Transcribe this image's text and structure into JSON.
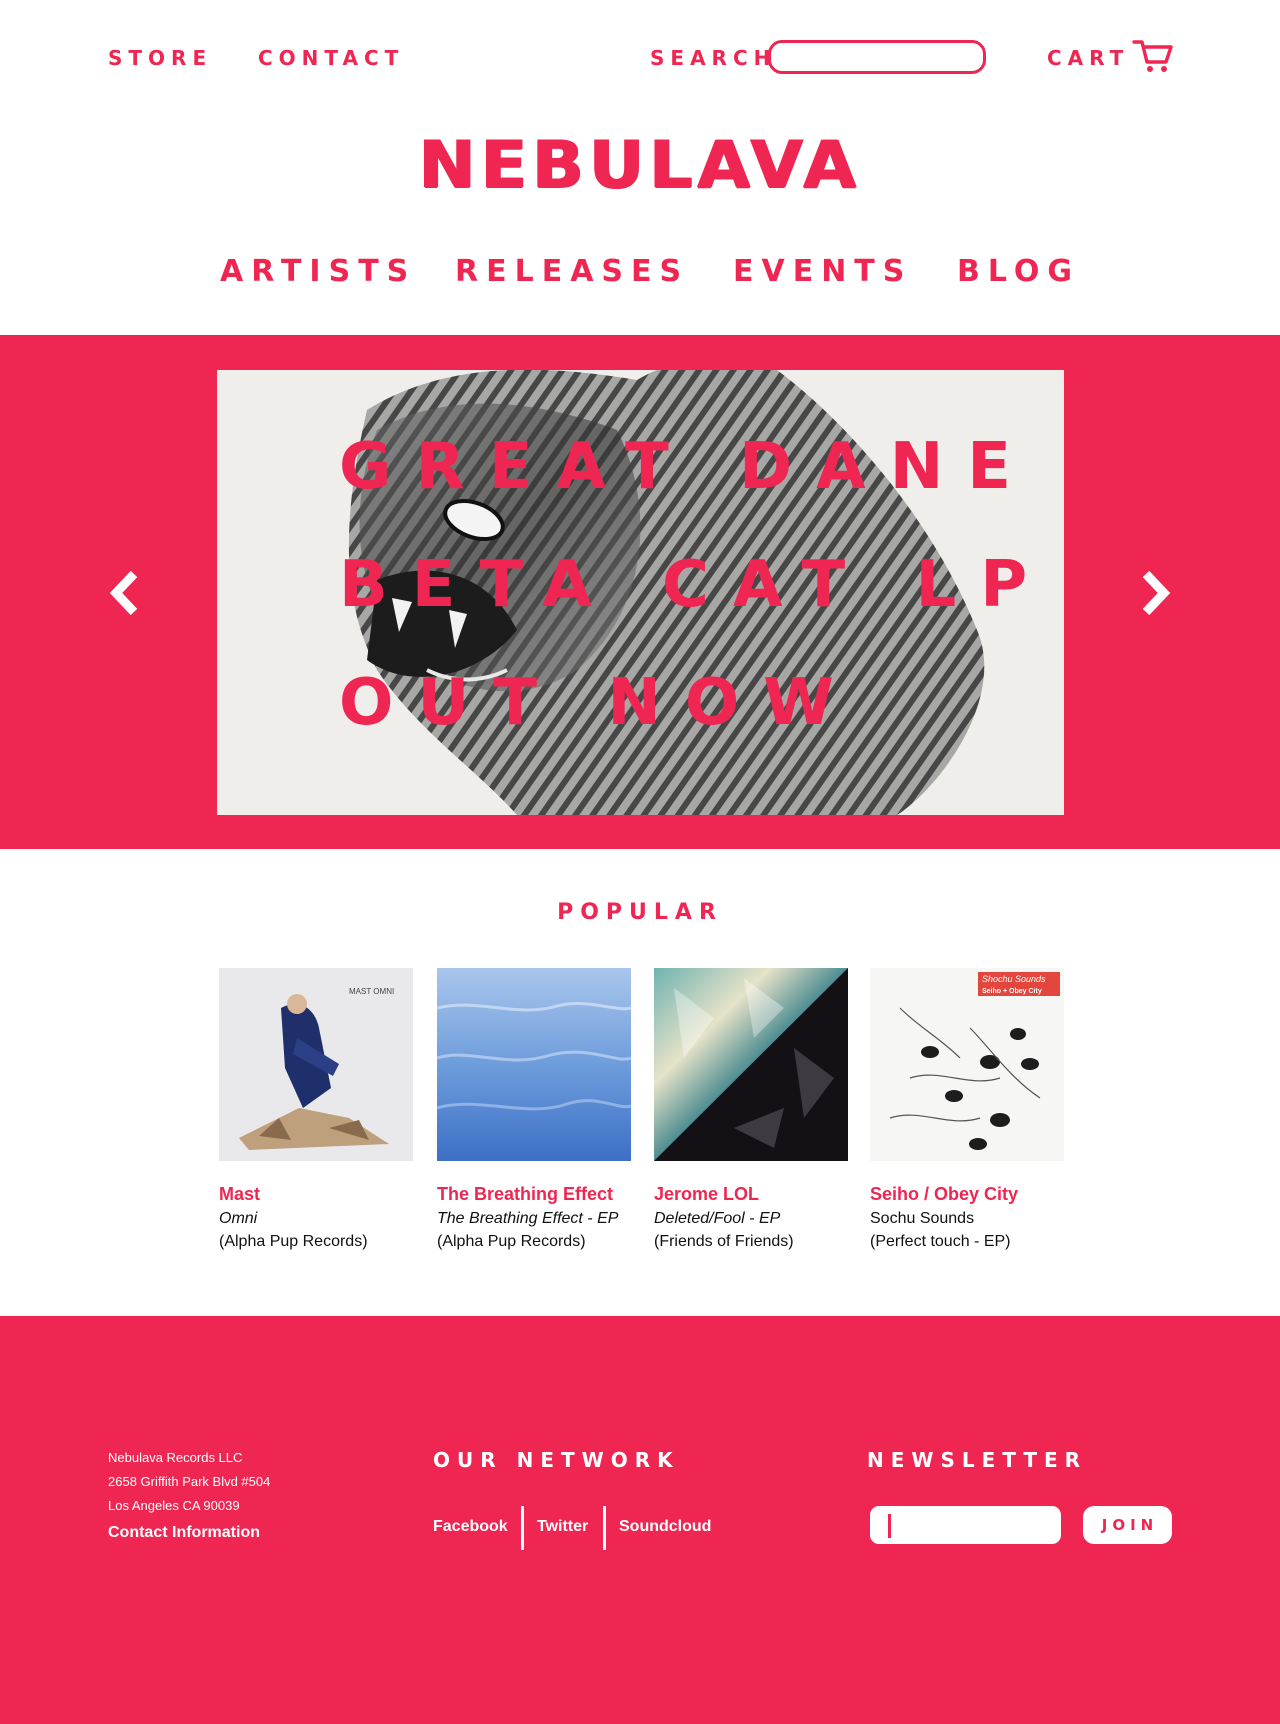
{
  "topbar": {
    "store": "STORE",
    "contact": "CONTACT",
    "search_label": "SEARCH",
    "search_value": "",
    "cart": "CART",
    "cart_icon": "cart-icon"
  },
  "logo": "NEBULAVA",
  "nav": [
    "ARTISTS",
    "RELEASES",
    "EVENTS",
    "BLOG"
  ],
  "hero": {
    "lines": [
      "GREAT DANE",
      "BETA CAT LP",
      "OUT NOW"
    ],
    "prev_icon": "chevron-left-icon",
    "next_icon": "chevron-right-icon"
  },
  "popular": {
    "title": "POPULAR",
    "items": [
      {
        "artist": "Mast",
        "title": "Omni",
        "label": "(Alpha Pup Records)",
        "cover_text": "MAST OMNI"
      },
      {
        "artist": "The Breathing Effect",
        "title": "The Breathing Effect - EP",
        "label": "(Alpha Pup Records)"
      },
      {
        "artist": "Jerome LOL",
        "title": "Deleted/Fool - EP",
        "label": "(Friends of Friends)"
      },
      {
        "artist": "Seiho / Obey City",
        "title": "Sochu Sounds",
        "label": "(Perfect touch - EP)",
        "cover_text_1": "Shochu Sounds",
        "cover_text_2": "Seiho + Obey City"
      }
    ]
  },
  "footer": {
    "address": [
      "Nebulava Records LLC",
      "2658 Griffith Park Blvd #504",
      "Los Angeles CA 90039"
    ],
    "contact_info": "Contact Information",
    "network_title": "OUR NETWORK",
    "network_links": [
      "Facebook",
      "Twitter",
      "Soundcloud"
    ],
    "newsletter_title": "NEWSLETTER",
    "newsletter_value": "",
    "join": "JOIN"
  },
  "colors": {
    "accent": "#ef2651",
    "background": "#ffffff"
  }
}
